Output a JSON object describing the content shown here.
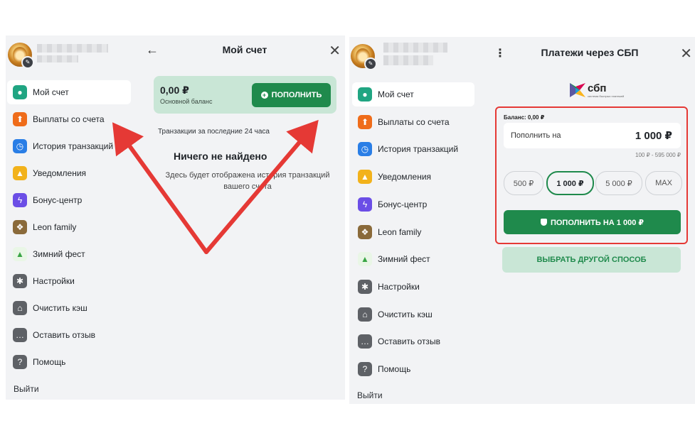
{
  "left": {
    "menu": [
      {
        "label": "Мой счет",
        "icon": "user-icon",
        "color": "#20a582",
        "active": true
      },
      {
        "label": "Выплаты со счета",
        "icon": "upload-icon",
        "color": "#ef6c1a"
      },
      {
        "label": "История транзакций",
        "icon": "clock-icon",
        "color": "#2a7ee6"
      },
      {
        "label": "Уведомления",
        "icon": "bell-icon",
        "color": "#f2b21b"
      },
      {
        "label": "Бонус-центр",
        "icon": "lightning-icon",
        "color": "#6b4ee6"
      },
      {
        "label": "Leon family",
        "icon": "paw-icon",
        "color": "#8a6a3a"
      },
      {
        "label": "Зимний фест",
        "icon": "tree-icon",
        "color": "#e9f6e6"
      },
      {
        "label": "Настройки",
        "icon": "gear-icon",
        "color": "#5e6166"
      },
      {
        "label": "Очистить кэш",
        "icon": "broom-icon",
        "color": "#5e6166"
      },
      {
        "label": "Оставить отзыв",
        "icon": "chat-icon",
        "color": "#5e6166"
      },
      {
        "label": "Помощь",
        "icon": "question-icon",
        "color": "#5e6166"
      }
    ],
    "logout": "Выйти",
    "header": {
      "title": "Мой счет",
      "back": "←",
      "close": "✕"
    },
    "balance": {
      "amount": "0,00 ₽",
      "label": "Основной баланс",
      "topup": "ПОПОЛНИТЬ"
    },
    "transactions_caption": "Транзакции за последние 24 часа",
    "empty_title": "Ничего не найдено",
    "empty_text": "Здесь будет отображена история транзакций вашего счета"
  },
  "right": {
    "menu": [
      {
        "label": "Мой счет",
        "icon": "user-icon",
        "color": "#20a582",
        "active": true
      },
      {
        "label": "Выплаты со счета",
        "icon": "upload-icon",
        "color": "#ef6c1a"
      },
      {
        "label": "История транзакций",
        "icon": "clock-icon",
        "color": "#2a7ee6"
      },
      {
        "label": "Уведомления",
        "icon": "bell-icon",
        "color": "#f2b21b"
      },
      {
        "label": "Бонус-центр",
        "icon": "lightning-icon",
        "color": "#6b4ee6"
      },
      {
        "label": "Leon family",
        "icon": "paw-icon",
        "color": "#8a6a3a"
      },
      {
        "label": "Зимний фест",
        "icon": "tree-icon",
        "color": "#e9f6e6"
      },
      {
        "label": "Настройки",
        "icon": "gear-icon",
        "color": "#5e6166"
      },
      {
        "label": "Очистить кэш",
        "icon": "broom-icon",
        "color": "#5e6166"
      },
      {
        "label": "Оставить отзыв",
        "icon": "chat-icon",
        "color": "#5e6166"
      },
      {
        "label": "Помощь",
        "icon": "question-icon",
        "color": "#5e6166"
      }
    ],
    "logout": "Выйти",
    "header": {
      "title": "Платежи через СБП",
      "menu": "⋮",
      "close": "✕"
    },
    "sbp_logo": "сбп",
    "sbp_tagline": "система быстрых платежей",
    "balance_label": "Баланс: 0,00 ₽",
    "amount_label": "Пополнить на",
    "amount_value": "1 000 ₽",
    "range": "100 ₽ - 595 000 ₽",
    "chips": [
      "500 ₽",
      "1 000 ₽",
      "5 000 ₽",
      "MAX"
    ],
    "active_chip_index": 1,
    "pay_button": "ПОПОЛНИТЬ НА 1 000 ₽",
    "other_method": "ВЫБРАТЬ ДРУГОЙ СПОСОБ"
  },
  "colors": {
    "accent_green": "#1f8a4c",
    "light_green": "#c9e6d6",
    "highlight_red": "#e53935",
    "arrow_red": "#e53935"
  }
}
